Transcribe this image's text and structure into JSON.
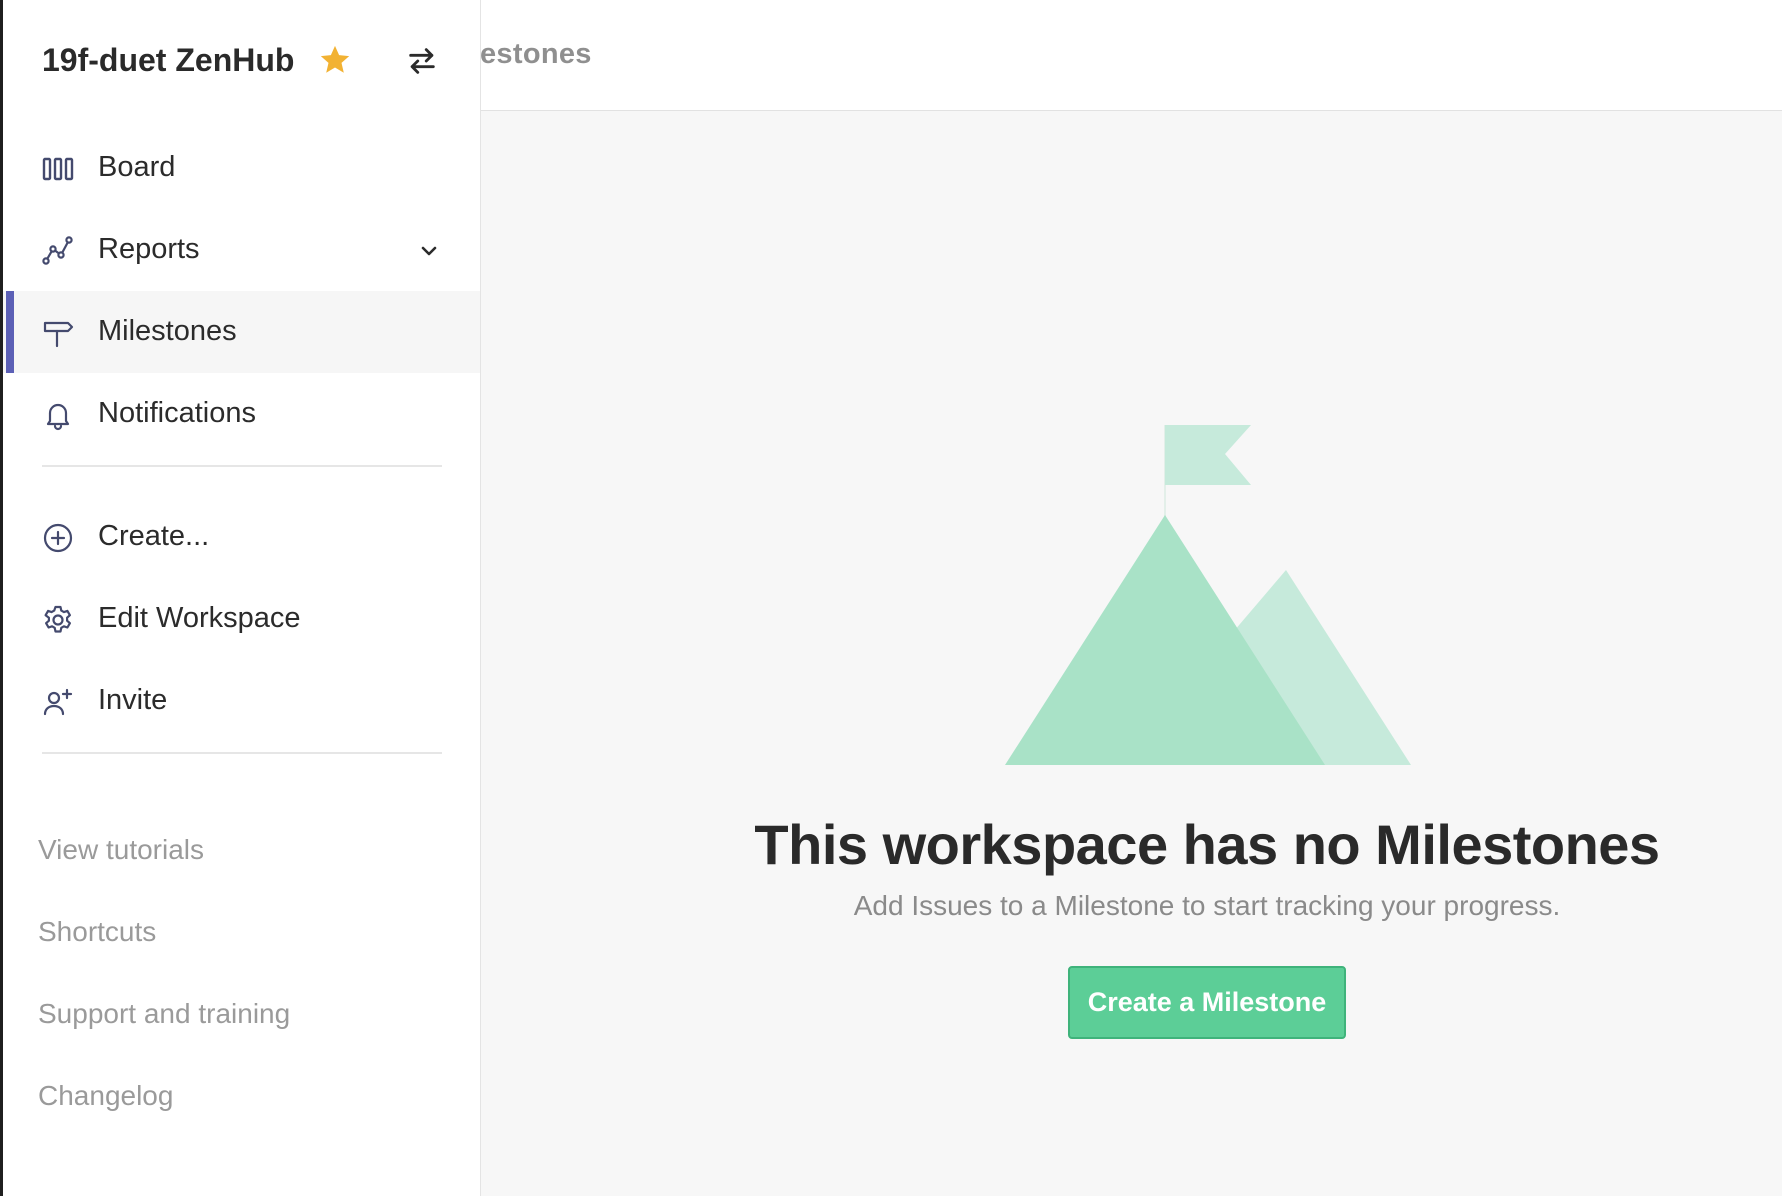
{
  "topbar": {
    "title": "estones"
  },
  "workspace": {
    "name": "19f-duet ZenHub",
    "star_color": "#f2b233"
  },
  "nav": {
    "items": [
      {
        "label": "Board",
        "icon": "board-columns-icon"
      },
      {
        "label": "Reports",
        "icon": "reports-chart-icon",
        "has_dropdown": true
      },
      {
        "label": "Milestones",
        "icon": "signpost-icon",
        "active": true
      },
      {
        "label": "Notifications",
        "icon": "bell-icon"
      }
    ],
    "actions": [
      {
        "label": "Create...",
        "icon": "plus-circle-icon"
      },
      {
        "label": "Edit Workspace",
        "icon": "gear-icon"
      },
      {
        "label": "Invite",
        "icon": "add-user-icon"
      }
    ],
    "links": [
      "View tutorials",
      "Shortcuts",
      "Support and training",
      "Changelog"
    ]
  },
  "empty_state": {
    "title": "This workspace has no Milestones",
    "subtitle": "Add Issues to a Milestone to start tracking your progress.",
    "button_label": "Create a Milestone",
    "illustration": "mountain-flag-icon"
  },
  "colors": {
    "accent": "#5c60b6",
    "button": "#5cce97",
    "mountain_front": "#a9e2c7",
    "mountain_back": "#c6eadb"
  }
}
